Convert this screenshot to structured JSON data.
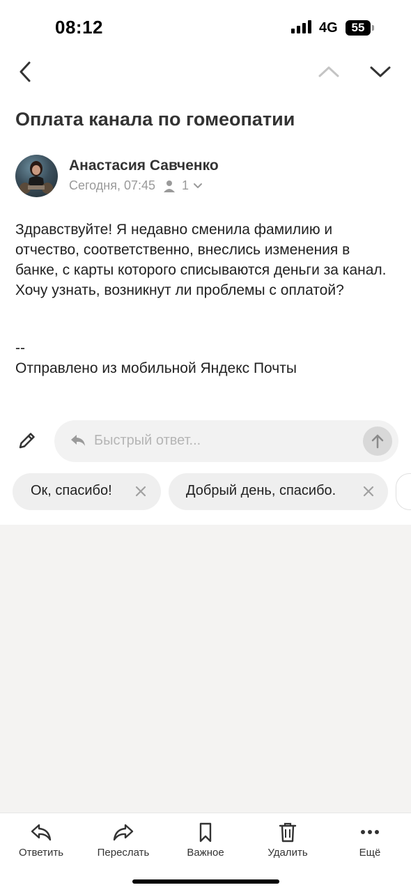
{
  "status": {
    "time": "08:12",
    "network": "4G",
    "battery": "55"
  },
  "email": {
    "subject": "Оплата канала по гомеопатии",
    "sender_name": "Анастасия Савченко",
    "date": "Сегодня, 07:45",
    "recipients_count": "1",
    "body": "Здравствуйте! Я недавно сменила фамилию и отчество, соответственно, внеслись изменения в банке, с карты которого списываются деньги за канал. Хочу узнать, возникнут ли проблемы с оплатой?",
    "signature_separator": "--",
    "signature": "Отправлено из мобильной Яндекс Почты"
  },
  "quick_reply": {
    "placeholder": "Быстрый ответ..."
  },
  "suggestions": [
    {
      "label": "Ок, спасибо!"
    },
    {
      "label": "Добрый день, спасибо."
    }
  ],
  "toolbar": {
    "reply": "Ответить",
    "forward": "Переслать",
    "important": "Важное",
    "delete": "Удалить",
    "more": "Ещё"
  },
  "colors": {
    "background": "#ffffff",
    "grey_area": "#f4f3f2",
    "chip": "#efefef",
    "placeholder": "#b5b5b5",
    "meta": "#9a9a9a"
  }
}
